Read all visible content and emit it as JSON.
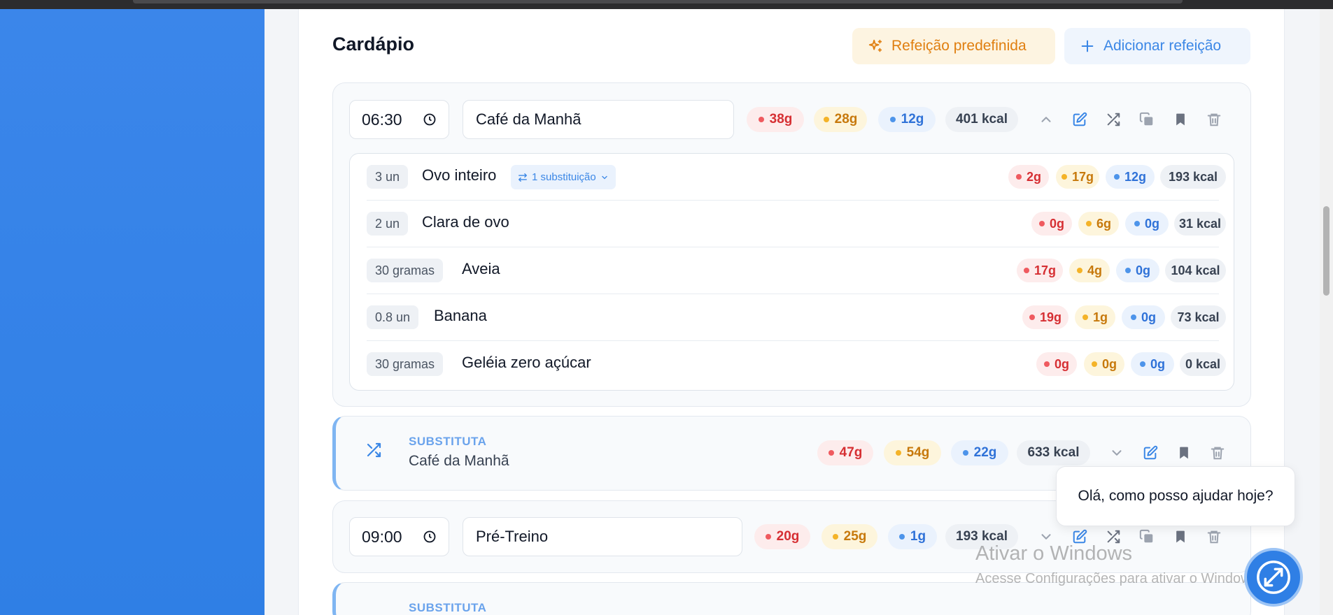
{
  "page": {
    "title": "Cardápio"
  },
  "buttons": {
    "preset": "Refeição predefinida",
    "add": "Adicionar refeição"
  },
  "meal1": {
    "time": "06:30",
    "name": "Café da Manhã",
    "macros": {
      "carb": "38g",
      "fat": "28g",
      "protein": "12g",
      "kcal": "401 kcal"
    },
    "foods": [
      {
        "qty": "3 un",
        "name": "Ovo inteiro",
        "substitution": "1 substituição",
        "carb": "2g",
        "fat": "17g",
        "protein": "12g",
        "kcal": "193 kcal"
      },
      {
        "qty": "2 un",
        "name": "Clara de ovo",
        "carb": "0g",
        "fat": "6g",
        "protein": "0g",
        "kcal": "31 kcal"
      },
      {
        "qty": "30 gramas",
        "name": "Aveia",
        "carb": "17g",
        "fat": "4g",
        "protein": "0g",
        "kcal": "104 kcal"
      },
      {
        "qty": "0.8 un",
        "name": "Banana",
        "carb": "19g",
        "fat": "1g",
        "protein": "0g",
        "kcal": "73 kcal"
      },
      {
        "qty": "30 gramas",
        "name": "Geléia zero açúcar",
        "carb": "0g",
        "fat": "0g",
        "protein": "0g",
        "kcal": "0 kcal"
      }
    ]
  },
  "substitute1": {
    "tag": "SUBSTITUTA",
    "name": "Café da Manhã",
    "macros": {
      "carb": "47g",
      "fat": "54g",
      "protein": "22g",
      "kcal": "633 kcal"
    }
  },
  "meal2": {
    "time": "09:00",
    "name": "Pré-Treino",
    "macros": {
      "carb": "20g",
      "fat": "25g",
      "protein": "1g",
      "kcal": "193 kcal"
    }
  },
  "substitute2": {
    "tag": "SUBSTITUTA"
  },
  "chat": {
    "greeting": "Olá, como posso ajudar hoje?"
  },
  "watermark": {
    "line1": "Ativar o Windows",
    "line2": "Acesse Configurações para ativar o Windows."
  },
  "colors": {
    "carb": "#ef5a5f",
    "fat": "#f4b328",
    "protein": "#4d94ea",
    "accent": "#3b87e6",
    "sidebar": "#2f7fe5"
  }
}
